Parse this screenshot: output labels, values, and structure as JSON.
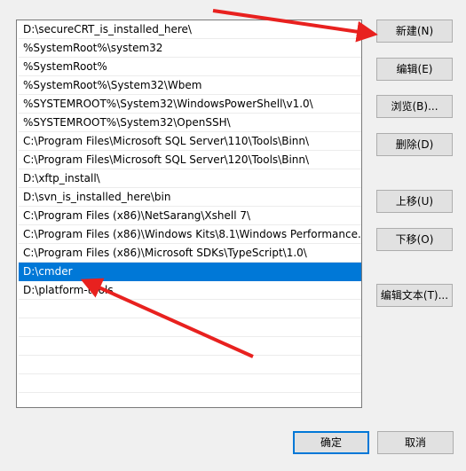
{
  "paths": [
    "D:\\secureCRT_is_installed_here\\",
    "%SystemRoot%\\system32",
    "%SystemRoot%",
    "%SystemRoot%\\System32\\Wbem",
    "%SYSTEMROOT%\\System32\\WindowsPowerShell\\v1.0\\",
    "%SYSTEMROOT%\\System32\\OpenSSH\\",
    "C:\\Program Files\\Microsoft SQL Server\\110\\Tools\\Binn\\",
    "C:\\Program Files\\Microsoft SQL Server\\120\\Tools\\Binn\\",
    "D:\\xftp_install\\",
    "D:\\svn_is_installed_here\\bin",
    "C:\\Program Files (x86)\\NetSarang\\Xshell 7\\",
    "C:\\Program Files (x86)\\Windows Kits\\8.1\\Windows Performance...",
    "C:\\Program Files (x86)\\Microsoft SDKs\\TypeScript\\1.0\\",
    "D:\\cmder",
    "D:\\platform-tools"
  ],
  "selected_index": 13,
  "buttons": {
    "new": "新建(N)",
    "edit": "编辑(E)",
    "browse": "浏览(B)...",
    "delete": "删除(D)",
    "move_up": "上移(U)",
    "move_down": "下移(O)",
    "edit_text": "编辑文本(T)...",
    "ok": "确定",
    "cancel": "取消"
  },
  "colors": {
    "selection": "#0078d7",
    "annotation_arrow": "#e8211f"
  }
}
